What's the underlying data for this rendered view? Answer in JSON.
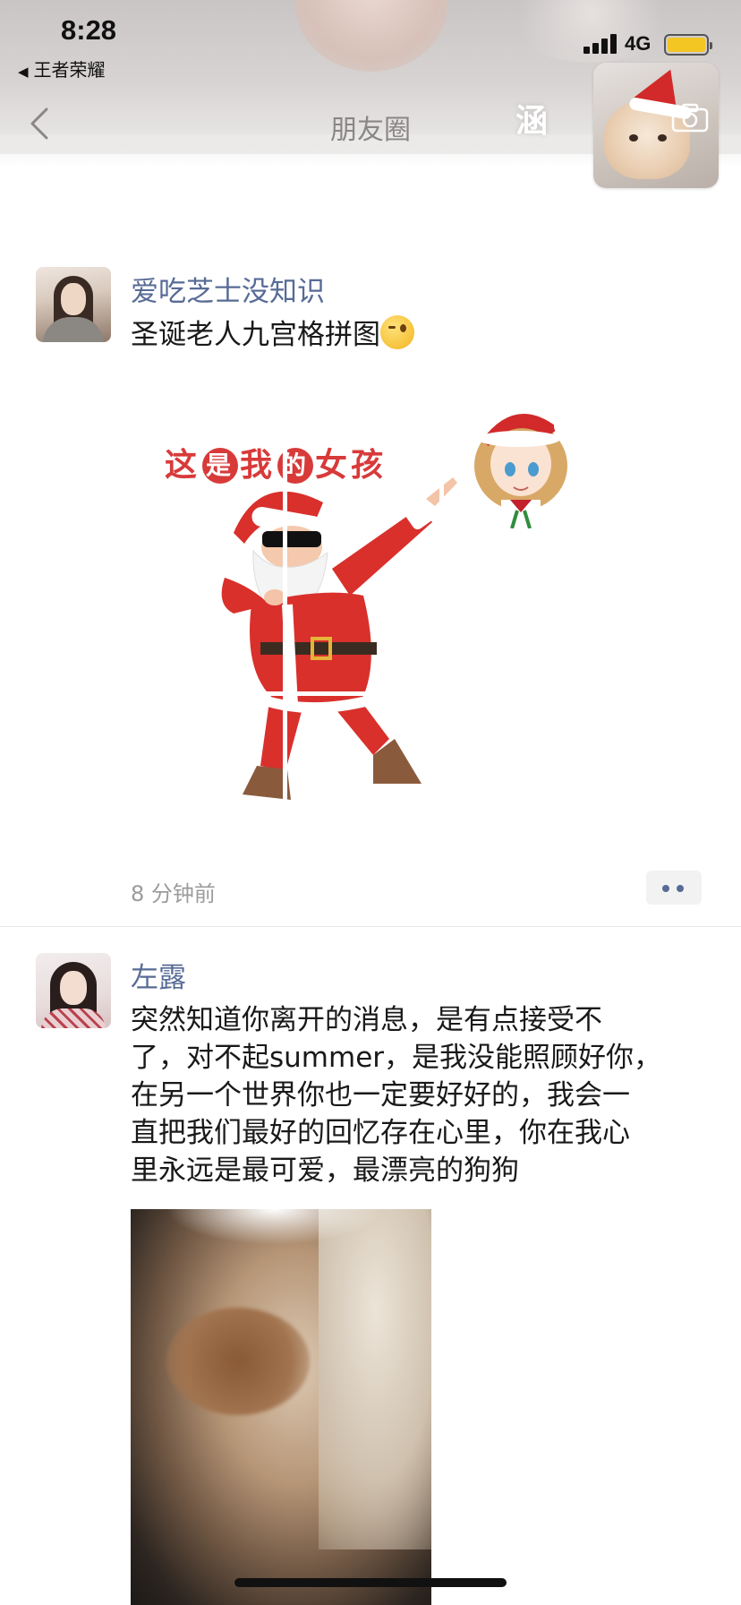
{
  "status_bar": {
    "time": "8:28",
    "back_app": "王者荣耀",
    "network": "4G",
    "battery_color": "#f3c623"
  },
  "nav": {
    "back_icon": "chevron-left-icon",
    "title": "朋友圈",
    "cover_name": "涵",
    "camera_icon": "camera-icon"
  },
  "posts": [
    {
      "author": "爱吃芝士没知识",
      "text": "圣诞老人九宫格拼图",
      "emoji": "wink-emoji",
      "image_slogan": {
        "chars": [
          "这",
          "是",
          "我",
          "的",
          "女",
          "孩"
        ]
      },
      "time": "8 分钟前",
      "more_icon": "more-dots-icon"
    },
    {
      "author": "左露",
      "text_lines": [
        "突然知道你离开的消息，是有点接受不",
        "了，对不起summer，是我没能照顾好你，",
        "在另一个世界你也一定要好好的，我会一",
        "直把我们最好的回忆存在心里，你在我心",
        "里永远是最可爱，最漂亮的狗狗"
      ]
    }
  ],
  "colors": {
    "name_link": "#576b95",
    "text": "#191919",
    "timestamp": "#9b9b9b"
  }
}
